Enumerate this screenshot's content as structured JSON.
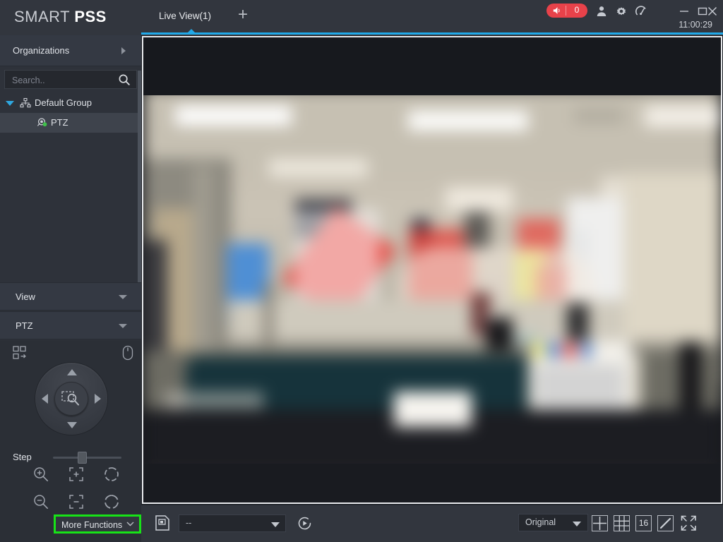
{
  "app": {
    "brand_smart": "SMART ",
    "brand_pss": "PSS",
    "clock": "11:00:29"
  },
  "titlebar": {
    "tab_label": "Live View(1)",
    "add_tab_glyph": "+",
    "alarm_count": "0",
    "alarm_icon": "speaker-icon",
    "user_icon": "user-icon",
    "settings_icon": "gear-icon",
    "gauge_icon": "gauge-icon",
    "minimize_icon": "minimize-icon",
    "maximize_icon": "maximize-icon",
    "close_icon": "close-icon",
    "accent_color": "#21a9e8",
    "alarm_color": "#e8424a"
  },
  "sidebar": {
    "organizations_label": "Organizations",
    "organizations_arrow_icon": "chevron-right-icon",
    "search": {
      "value": "",
      "placeholder": "Search..",
      "icon": "search-icon"
    },
    "tree": [
      {
        "label": "Default Group",
        "icon": "sitemap-icon",
        "expanded": true,
        "selected": false
      },
      {
        "label": "PTZ",
        "icon": "camera-icon",
        "status": "online",
        "status_color": "#3fc04a",
        "selected": true
      }
    ],
    "panels": [
      {
        "label": "View",
        "collapsed": true,
        "chevron": "chevron-down-icon"
      },
      {
        "label": "PTZ",
        "collapsed": false,
        "chevron": "chevron-down-icon"
      }
    ]
  },
  "ptz": {
    "preset_icon": "grid-arrow-icon",
    "mouse_icon": "mouse-icon",
    "dpad": {
      "up": "arrow-up-icon",
      "down": "arrow-down-icon",
      "left": "arrow-left-icon",
      "right": "arrow-right-icon",
      "center": "zoom-area-icon"
    },
    "step_label": "Step",
    "step_value": 45,
    "functions": [
      {
        "name": "zoom-in-icon"
      },
      {
        "name": "focus-near-icon"
      },
      {
        "name": "iris-open-icon"
      },
      {
        "name": "zoom-out-icon"
      },
      {
        "name": "focus-far-icon"
      },
      {
        "name": "iris-close-icon"
      }
    ],
    "more_functions_label": "More Functions",
    "more_functions_chevron": "chevron-down-icon",
    "highlight_color": "#17e317"
  },
  "bottombar": {
    "save_icon": "save-snapshot-icon",
    "preset_select": {
      "value": "--",
      "chevron": "chevron-down-icon"
    },
    "refresh_icon": "tour-refresh-icon",
    "ratio_select": {
      "value": "Original",
      "chevron": "chevron-down-icon"
    },
    "layouts": [
      {
        "name": "layout-4-split-icon",
        "label": ""
      },
      {
        "name": "layout-9-split-icon",
        "label": ""
      },
      {
        "name": "layout-16-split-icon",
        "label": "16"
      },
      {
        "name": "layout-edit-icon",
        "label": ""
      }
    ],
    "fullscreen_icon": "fullscreen-icon"
  },
  "video": {
    "selected": true,
    "border_color": "#e9ebee",
    "description": "blurred indoor office counter scene"
  }
}
